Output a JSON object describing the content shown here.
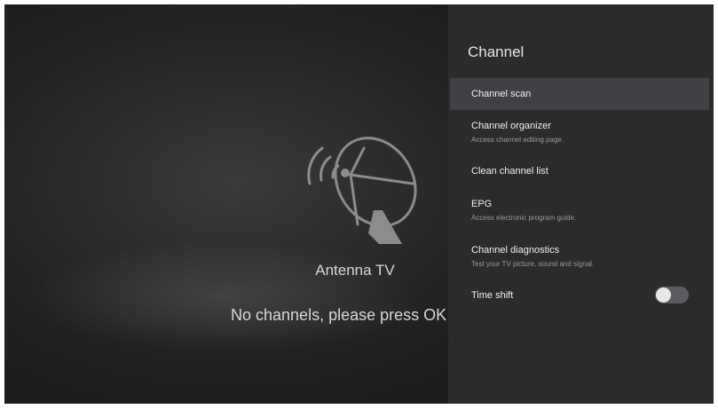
{
  "main": {
    "icon": "antenna-dish-icon",
    "source_title": "Antenna TV",
    "message": "No channels, please press OK to"
  },
  "panel": {
    "title": "Channel",
    "items": [
      {
        "label": "Channel scan",
        "desc": ""
      },
      {
        "label": "Channel organizer",
        "desc": "Access channel editing page."
      },
      {
        "label": "Clean channel list",
        "desc": ""
      },
      {
        "label": "EPG",
        "desc": "Access electronic program guide."
      },
      {
        "label": "Channel diagnostics",
        "desc": "Test your TV picture, sound and signal."
      },
      {
        "label": "Time shift",
        "desc": ""
      }
    ],
    "time_shift_enabled": false
  },
  "colors": {
    "panel_bg": "#2a2b2d",
    "selected_bg": "#404144",
    "toggle_off": "#5b5c5f"
  }
}
